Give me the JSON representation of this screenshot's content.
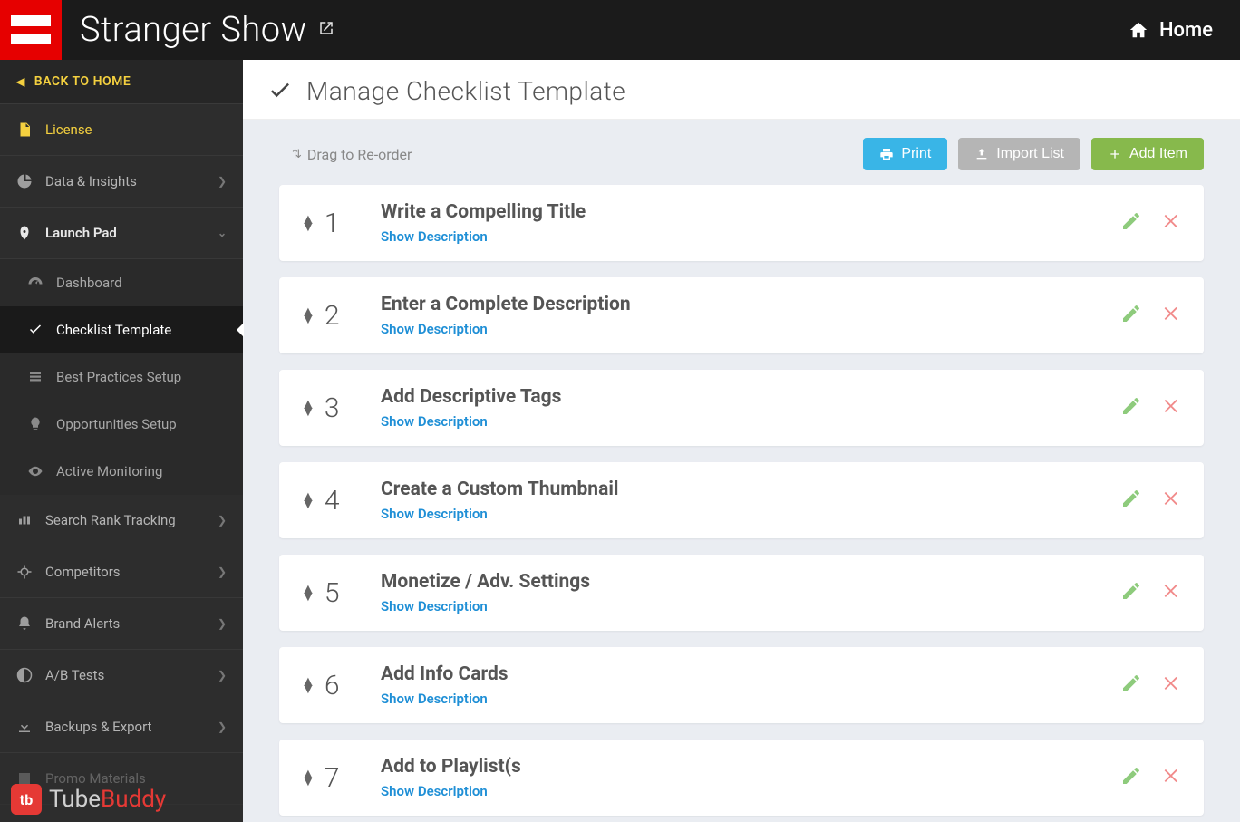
{
  "header": {
    "app_title": "Stranger Show",
    "home_label": "Home"
  },
  "sidebar": {
    "back_label": "BACK TO HOME",
    "license_label": "License",
    "items": [
      {
        "label": "Data & Insights"
      },
      {
        "label": "Launch Pad"
      },
      {
        "label": "Search Rank Tracking"
      },
      {
        "label": "Competitors"
      },
      {
        "label": "Brand Alerts"
      },
      {
        "label": "A/B Tests"
      },
      {
        "label": "Backups & Export"
      },
      {
        "label": "Promo Materials"
      }
    ],
    "launch_sub": [
      {
        "label": "Dashboard"
      },
      {
        "label": "Checklist Template"
      },
      {
        "label": "Best Practices Setup"
      },
      {
        "label": "Opportunities Setup"
      },
      {
        "label": "Active Monitoring"
      }
    ],
    "brand1": "Tube",
    "brand2": "Buddy",
    "brand_logo": "tb"
  },
  "page": {
    "title": "Manage Checklist Template",
    "drag_hint": "Drag to Re-order",
    "print_label": "Print",
    "import_label": "Import List",
    "add_label": "Add Item",
    "show_desc_label": "Show Description",
    "checklist": [
      {
        "n": "1",
        "title": "Write a Compelling Title"
      },
      {
        "n": "2",
        "title": "Enter a Complete Description"
      },
      {
        "n": "3",
        "title": "Add Descriptive Tags"
      },
      {
        "n": "4",
        "title": "Create a Custom Thumbnail"
      },
      {
        "n": "5",
        "title": "Monetize / Adv. Settings"
      },
      {
        "n": "6",
        "title": "Add Info Cards"
      },
      {
        "n": "7",
        "title": "Add to Playlist(s"
      }
    ]
  }
}
